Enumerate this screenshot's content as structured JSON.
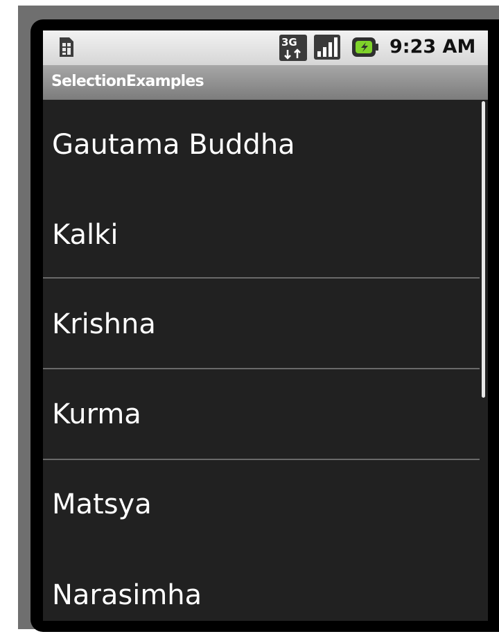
{
  "status_bar": {
    "time": "9:23 AM",
    "network_label": "3G",
    "icons": [
      "sim-card-icon",
      "network-3g-icon",
      "signal-strength-icon",
      "battery-charging-icon"
    ]
  },
  "title_bar": {
    "title": "SelectionExamples"
  },
  "list": {
    "items": [
      {
        "label": "Gautama Buddha"
      },
      {
        "label": "Kalki"
      },
      {
        "label": "Krishna"
      },
      {
        "label": "Kurma"
      },
      {
        "label": "Matsya"
      },
      {
        "label": "Narasimha"
      }
    ]
  },
  "colors": {
    "list_background": "#212121",
    "list_text": "#ffffff",
    "divider": "#6a6a6a",
    "status_bar": "#e4e4e4",
    "title_bar": "#8f8f8f",
    "battery_accent": "#7fd32a"
  }
}
